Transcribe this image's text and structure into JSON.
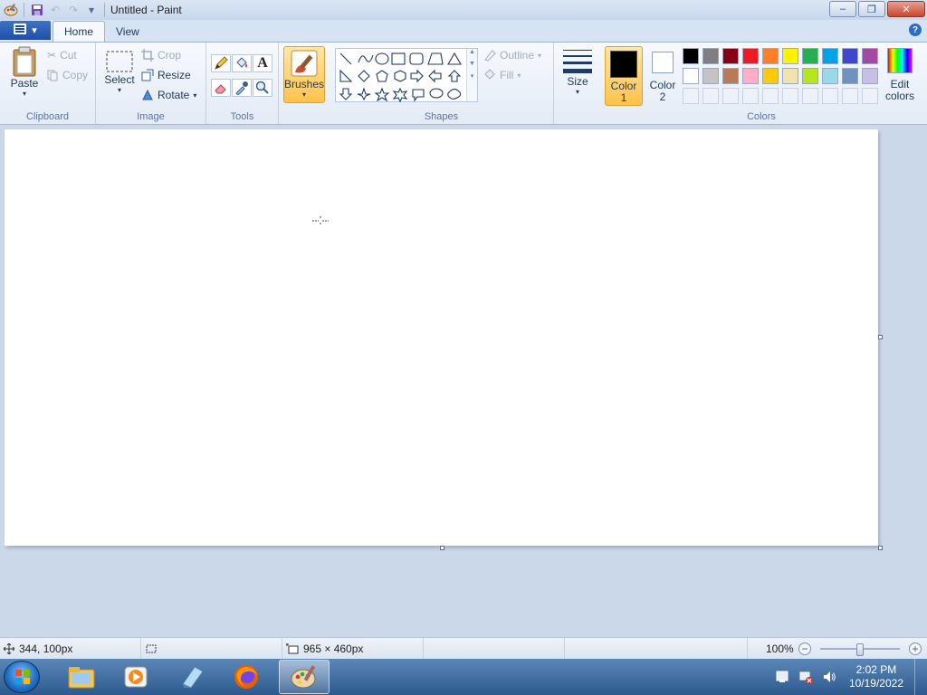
{
  "window": {
    "title": "Untitled - Paint",
    "controls": {
      "minimize": "–",
      "restore": "❐",
      "close": "✕"
    }
  },
  "tabs": {
    "home": "Home",
    "view": "View"
  },
  "ribbon": {
    "clipboard": {
      "label": "Clipboard",
      "paste": "Paste",
      "cut": "Cut",
      "copy": "Copy"
    },
    "image": {
      "label": "Image",
      "select": "Select",
      "crop": "Crop",
      "resize": "Resize",
      "rotate": "Rotate"
    },
    "tools": {
      "label": "Tools"
    },
    "brushes": {
      "label": "Brushes"
    },
    "shapes": {
      "label": "Shapes",
      "outline": "Outline",
      "fill": "Fill"
    },
    "size": {
      "label": "Size"
    },
    "colors": {
      "label": "Colors",
      "color1": [
        "Color",
        "1"
      ],
      "color2": [
        "Color",
        "2"
      ],
      "edit": [
        "Edit",
        "colors"
      ],
      "row1": [
        "#000000",
        "#7f7f7f",
        "#880015",
        "#ed1c24",
        "#ff7f27",
        "#fff200",
        "#22b14c",
        "#00a2e8",
        "#3f48cc",
        "#a349a4"
      ],
      "row2": [
        "#ffffff",
        "#c3c3c3",
        "#b97a57",
        "#ffaec9",
        "#ffc90e",
        "#efe4b0",
        "#b5e61d",
        "#99d9ea",
        "#7092be",
        "#c8bfe7"
      ]
    }
  },
  "status": {
    "cursor_pos": "344, 100px",
    "canvas_size": "965 × 460px",
    "zoom": "100%"
  },
  "taskbar": {
    "time": "2:02 PM",
    "date": "10/19/2022"
  }
}
